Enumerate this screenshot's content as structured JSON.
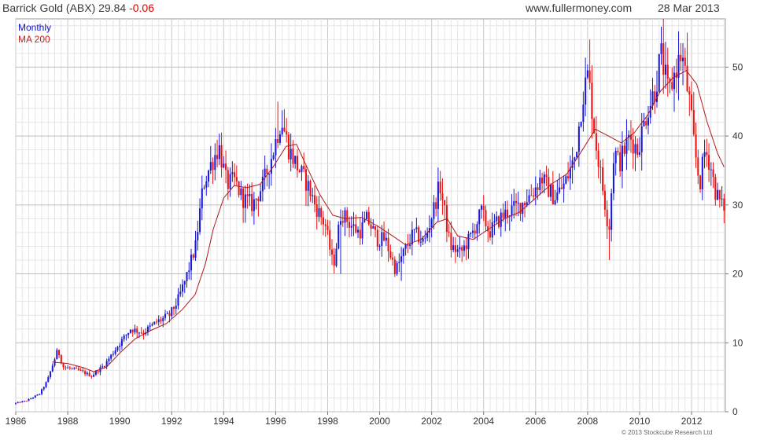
{
  "header": {
    "title_name": "Barrick Gold (ABX)",
    "title_price": "29.84",
    "title_change": "-0.06",
    "site": "www.fullermoney.com",
    "date": "28 Mar 2013"
  },
  "footer": {
    "copyright": "© 2013 Stockcube Research Ltd"
  },
  "chart_data": {
    "type": "candlestick",
    "title": "Barrick Gold (ABX) 29.84 -0.06",
    "frequency": "Monthly",
    "legend": [
      {
        "label": "Monthly",
        "color": "#1010cc"
      },
      {
        "label": "MA 200",
        "color": "#cc2020"
      }
    ],
    "colors": {
      "up": "#1a1ad6",
      "down": "#ee1111",
      "ma": "#b01818",
      "grid": "#cfcfcf"
    },
    "x_ticks": [
      "1986",
      "1988",
      "1990",
      "1992",
      "1994",
      "1996",
      "1998",
      "2000",
      "2002",
      "2004",
      "2006",
      "2008",
      "2010",
      "2012"
    ],
    "xlim": [
      1986.0,
      2013.3
    ],
    "y_ticks": [
      0,
      10,
      20,
      30,
      40,
      50
    ],
    "ylim": [
      0,
      57
    ],
    "y_axis_side": "right",
    "grid": true,
    "price_path": [
      [
        1986.0,
        1.2
      ],
      [
        1986.5,
        1.6
      ],
      [
        1987.0,
        2.6
      ],
      [
        1987.3,
        4.5
      ],
      [
        1987.7,
        9.0
      ],
      [
        1987.9,
        6.5
      ],
      [
        1988.5,
        6.0
      ],
      [
        1989.0,
        5.2
      ],
      [
        1989.5,
        6.8
      ],
      [
        1990.0,
        9.5
      ],
      [
        1990.5,
        12.0
      ],
      [
        1991.0,
        11.5
      ],
      [
        1991.5,
        13.0
      ],
      [
        1992.0,
        14.0
      ],
      [
        1992.3,
        16.0
      ],
      [
        1992.6,
        19.0
      ],
      [
        1993.0,
        24.0
      ],
      [
        1993.3,
        33.0
      ],
      [
        1993.6,
        36.0
      ],
      [
        1993.9,
        38.5
      ],
      [
        1994.2,
        33.0
      ],
      [
        1994.5,
        33.5
      ],
      [
        1994.8,
        31.0
      ],
      [
        1995.2,
        30.0
      ],
      [
        1995.6,
        33.0
      ],
      [
        1996.0,
        38.0
      ],
      [
        1996.3,
        42.5
      ],
      [
        1996.6,
        38.0
      ],
      [
        1997.0,
        35.0
      ],
      [
        1997.3,
        33.0
      ],
      [
        1997.6,
        30.0
      ],
      [
        1998.0,
        27.0
      ],
      [
        1998.3,
        21.0
      ],
      [
        1998.6,
        29.0
      ],
      [
        1999.0,
        27.0
      ],
      [
        1999.3,
        26.0
      ],
      [
        1999.6,
        28.0
      ],
      [
        2000.0,
        25.0
      ],
      [
        2000.3,
        25.0
      ],
      [
        2000.7,
        20.5
      ],
      [
        2001.0,
        23.0
      ],
      [
        2001.4,
        26.0
      ],
      [
        2001.8,
        24.5
      ],
      [
        2002.2,
        30.0
      ],
      [
        2002.4,
        33.0
      ],
      [
        2002.8,
        24.0
      ],
      [
        2003.2,
        23.0
      ],
      [
        2003.6,
        25.5
      ],
      [
        2004.0,
        29.0
      ],
      [
        2004.3,
        26.0
      ],
      [
        2004.7,
        28.0
      ],
      [
        2005.0,
        29.0
      ],
      [
        2005.5,
        30.0
      ],
      [
        2006.0,
        32.0
      ],
      [
        2006.3,
        34.0
      ],
      [
        2006.8,
        31.0
      ],
      [
        2007.2,
        33.0
      ],
      [
        2007.6,
        37.0
      ],
      [
        2007.9,
        46.0
      ],
      [
        2008.1,
        49.0
      ],
      [
        2008.4,
        39.0
      ],
      [
        2008.8,
        29.0
      ],
      [
        2008.9,
        26.0
      ],
      [
        2009.1,
        38.0
      ],
      [
        2009.3,
        36.0
      ],
      [
        2009.7,
        40.0
      ],
      [
        2010.0,
        38.0
      ],
      [
        2010.4,
        44.0
      ],
      [
        2010.7,
        47.0
      ],
      [
        2010.9,
        52.0
      ],
      [
        2011.2,
        46.0
      ],
      [
        2011.5,
        50.0
      ],
      [
        2011.7,
        52.0
      ],
      [
        2012.0,
        45.0
      ],
      [
        2012.2,
        38.0
      ],
      [
        2012.4,
        33.0
      ],
      [
        2012.6,
        38.0
      ],
      [
        2012.8,
        36.0
      ],
      [
        2013.0,
        32.0
      ],
      [
        2013.25,
        29.84
      ]
    ],
    "ma200_path": [
      [
        1987.4,
        7.2
      ],
      [
        1988.0,
        7.0
      ],
      [
        1988.6,
        6.4
      ],
      [
        1989.0,
        5.8
      ],
      [
        1989.5,
        6.5
      ],
      [
        1990.0,
        8.5
      ],
      [
        1990.6,
        10.6
      ],
      [
        1991.2,
        11.8
      ],
      [
        1991.8,
        12.8
      ],
      [
        1992.4,
        14.8
      ],
      [
        1992.9,
        17.0
      ],
      [
        1993.3,
        21.5
      ],
      [
        1993.6,
        26.5
      ],
      [
        1994.0,
        31.0
      ],
      [
        1994.4,
        32.8
      ],
      [
        1994.9,
        32.5
      ],
      [
        1995.4,
        33.0
      ],
      [
        1995.9,
        35.5
      ],
      [
        1996.4,
        38.5
      ],
      [
        1996.8,
        38.8
      ],
      [
        1997.2,
        35.5
      ],
      [
        1997.7,
        31.5
      ],
      [
        1998.2,
        28.5
      ],
      [
        1998.7,
        28.0
      ],
      [
        1999.3,
        28.2
      ],
      [
        1999.9,
        27.0
      ],
      [
        2000.5,
        25.5
      ],
      [
        2001.0,
        24.2
      ],
      [
        2001.6,
        25.0
      ],
      [
        2002.2,
        27.5
      ],
      [
        2002.6,
        28.0
      ],
      [
        2003.0,
        25.5
      ],
      [
        2003.6,
        25.0
      ],
      [
        2004.2,
        26.5
      ],
      [
        2004.8,
        28.0
      ],
      [
        2005.4,
        29.0
      ],
      [
        2006.0,
        31.0
      ],
      [
        2006.6,
        33.0
      ],
      [
        2007.2,
        34.5
      ],
      [
        2007.8,
        38.0
      ],
      [
        2008.3,
        41.0
      ],
      [
        2008.8,
        40.0
      ],
      [
        2009.3,
        39.0
      ],
      [
        2009.8,
        40.5
      ],
      [
        2010.3,
        43.0
      ],
      [
        2010.8,
        46.5
      ],
      [
        2011.3,
        48.5
      ],
      [
        2011.8,
        49.5
      ],
      [
        2012.2,
        47.5
      ],
      [
        2012.6,
        42.0
      ],
      [
        2013.0,
        37.5
      ],
      [
        2013.25,
        35.5
      ]
    ],
    "lows": [
      {
        "x": 1986.0,
        "y": 1.0
      },
      {
        "x": 1998.5,
        "y": 20.0
      },
      {
        "x": 2000.8,
        "y": 19.0
      },
      {
        "x": 2008.8,
        "y": 22.0
      },
      {
        "x": 2013.25,
        "y": 29.0
      }
    ],
    "highs": [
      {
        "x": 1993.9,
        "y": 40.5
      },
      {
        "x": 1996.1,
        "y": 45.0
      },
      {
        "x": 2008.1,
        "y": 54.0
      },
      {
        "x": 2010.9,
        "y": 56.0
      },
      {
        "x": 2011.8,
        "y": 55.0
      }
    ]
  }
}
